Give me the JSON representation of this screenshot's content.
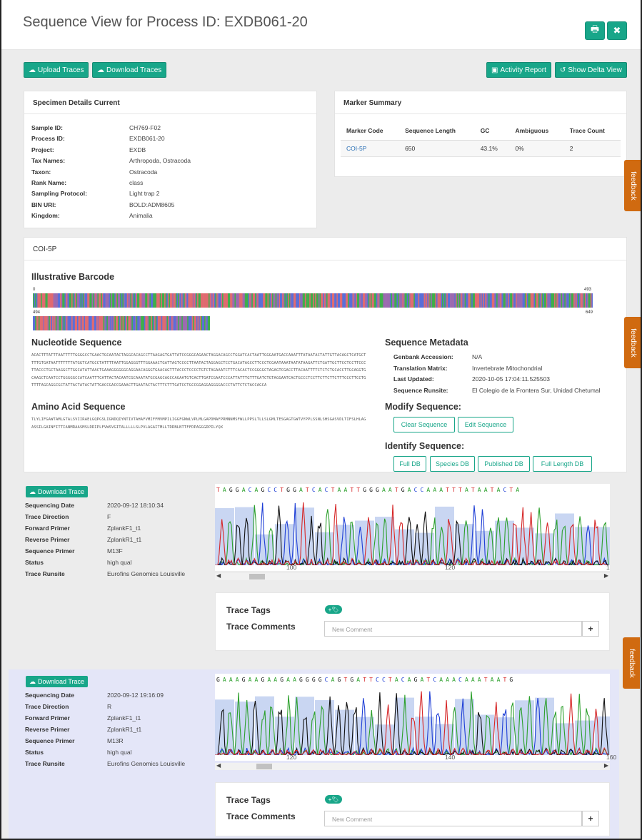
{
  "header": {
    "title": "Sequence View for Process ID: EXDB061-20",
    "print_icon": "print-icon",
    "close_icon": "close-icon",
    "print_glyph": "🖶",
    "close_glyph": "✖"
  },
  "toolbar": {
    "upload_traces": "Upload Traces",
    "download_traces": "Download Traces",
    "activity_report": "Activity Report",
    "show_delta_view": "Show Delta View"
  },
  "specimen": {
    "heading": "Specimen Details Current",
    "fields": [
      {
        "label": "Sample ID:",
        "value": "CH769-F02"
      },
      {
        "label": "Process ID:",
        "value": "EXDB061-20"
      },
      {
        "label": "Project:",
        "value": "EXDB"
      },
      {
        "label": "Tax Names:",
        "value": "Arthropoda, Ostracoda"
      },
      {
        "label": "Taxon:",
        "value": "Ostracoda"
      },
      {
        "label": "Rank Name:",
        "value": "class"
      },
      {
        "label": "Sampling Protocol:",
        "value": "Light trap 2"
      },
      {
        "label": "BIN URI:",
        "value": "BOLD:ADM8605"
      },
      {
        "label": "Kingdom:",
        "value": "Animalia"
      }
    ]
  },
  "marker_summary": {
    "heading": "Marker Summary",
    "columns": [
      "Marker Code",
      "Sequence Length",
      "GC",
      "Ambiguous",
      "Trace Count"
    ],
    "rows": [
      [
        "COI-5P",
        "650",
        "43.1%",
        "0%",
        "2"
      ]
    ]
  },
  "feedback_label": "feedback",
  "marker": {
    "heading": "COI-5P",
    "barcode_title": "Illustrative Barcode",
    "barcode_row1_start": "0",
    "barcode_row1_end": "493",
    "barcode_row2_start": "494",
    "barcode_row2_end": "649",
    "nucleotide_title": "Nucleotide Sequence",
    "nucleotide_sequence": "ACACTTTATTTAATTTTTGGGGCCTGAACTGCAATACTAGGCACAGCCTTAAGAGTGATTATCCGGGCAGAACTAGGACAGCCTGGATCACTAATTGGGAATGACCAAATTTATAATACTATTGTTACAGCTCATGCTTTTGTGATAATTTTTTTATGGTCATGCCTATTTTAATTGGAGGGTTTGGAAACTGATTAGTCCCCTTAATACTAGGAGCTCCTGACATAGCCTTCCCTCGAATAAATAATATAAGATTCTGATTGCTTCCTCCTTCCCTTACCCTGCTAAGGCTTGGCATATTAACTGAAAGGGGGGCAGGAACAGGGTGAACAGTTTACCCTCCCCTGTCTAGAAATCTTTCACACTCCGGGGCTAGAGTCGACCTTACAATTTTCTCTCTGCACCTTGCAGGTGCAAGCTCAATCCTGGGGGCCATCAATTTCATTACTACAATCGCAAATATGCGAGCAGCCAGAATGTCACTTGATCGAATCCCATTATTTGTTTGATCTGTAGGAATCACTGCCCTCCTTCTTCTTCTTTCCCTTCCTGTTTTAGCAGGCGCTATTACTATACTATTGACCGACCGAAACTTGAATACTACTTTCTTTGATCCTGCCGGAGGAGGGGACCCTATTCTCTACCAGCA",
    "amino_title": "Amino Acid Sequence",
    "amino_sequence": "TLYLIFGAWTAMLGTALSVIIRAELGQPGSLIGNDQIYNTIVTAHAFVMIFFMVMPILIGGFGNWLVPLMLGAPDMAFPRMNNMSFWLLPPSLTLLSLGMLTESGAGTGWTVYPPLSSNLSHSGASVDLTIFSLHLAGASSILGAINFITTIANMRAASMSLDRIPLFVWSVGITALLLLLSLPVLAGAITMLLTDRNLNTTFFDPAGGGDPILYQX",
    "metadata_title": "Sequence Metadata",
    "metadata": [
      {
        "label": "Genbank Accession:",
        "value": "N/A"
      },
      {
        "label": "Translation Matrix:",
        "value": "Invertebrate Mitochondrial"
      },
      {
        "label": "Last Updated:",
        "value": "2020-10-05 17:04:11.525503"
      },
      {
        "label": "Sequence Runsite:",
        "value": "El Colegio de la Frontera Sur, Unidad Chetumal"
      }
    ],
    "modify_title": "Modify Sequence:",
    "clear_sequence": "Clear Sequence",
    "edit_sequence": "Edit Sequence",
    "identify_title": "Identify Sequence:",
    "identify_buttons": [
      "Full DB",
      "Species DB",
      "Published DB",
      "Full Length DB"
    ]
  },
  "traces": [
    {
      "download_label": "Download Trace",
      "fields": [
        {
          "label": "Sequencing Date",
          "value": "2020-09-12 18:10:34"
        },
        {
          "label": "Trace Direction",
          "value": "F"
        },
        {
          "label": "Forward Primer",
          "value": "ZplankF1_t1"
        },
        {
          "label": "Reverse Primer",
          "value": "ZplankR1_t1"
        },
        {
          "label": "Sequence Primer",
          "value": "M13F"
        },
        {
          "label": "Status",
          "value": "high qual"
        },
        {
          "label": "Trace Runsite",
          "value": "Eurofins Genomics Louisville"
        }
      ],
      "bases": "TAGGACAGCCTGGATCACTAATTGGGAATGACCAAATTTATAATACTA",
      "ticks": [
        "100",
        "120",
        "1"
      ],
      "tags_label": "Trace Tags",
      "comments_label": "Trace Comments",
      "comment_placeholder": "New Comment",
      "add_glyph": "+",
      "tag_glyph": "+🏷",
      "scroll_left": "◀",
      "scroll_right": "▶"
    },
    {
      "download_label": "Download Trace",
      "fields": [
        {
          "label": "Sequencing Date",
          "value": "2020-09-12 19:16:09"
        },
        {
          "label": "Trace Direction",
          "value": "R"
        },
        {
          "label": "Forward Primer",
          "value": "ZplankF1_t1"
        },
        {
          "label": "Reverse Primer",
          "value": "ZplankR1_t1"
        },
        {
          "label": "Sequence Primer",
          "value": "M13R"
        },
        {
          "label": "Status",
          "value": "high qual"
        },
        {
          "label": "Trace Runsite",
          "value": "Eurofins Genomics Louisville"
        }
      ],
      "bases": "GAAAGAAGAAGAAGGGGCAGTGATTCCTACAGATCAAACAAATAATG",
      "ticks": [
        "120",
        "140",
        "160"
      ],
      "tags_label": "Trace Tags",
      "comments_label": "Trace Comments",
      "comment_placeholder": "New Comment",
      "add_glyph": "+",
      "tag_glyph": "+🏷",
      "scroll_left": "◀",
      "scroll_right": "▶"
    }
  ],
  "colors": {
    "accent": "#18a689",
    "feedback": "#d06a10",
    "base_A": "#2ca02c",
    "base_C": "#1f3fd6",
    "base_G": "#111111",
    "base_T": "#d62728",
    "quality_bar": "#c9d6f2",
    "trace2_bg": "#e4e6f8"
  }
}
